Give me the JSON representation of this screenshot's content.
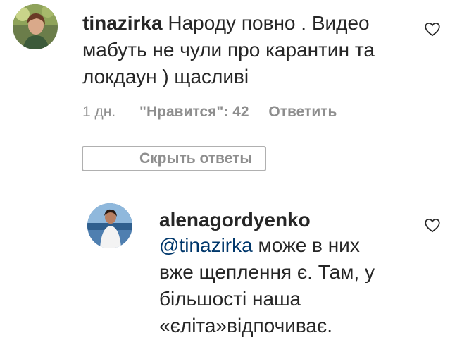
{
  "comments": [
    {
      "username": "tinazirka",
      "text": "Народу повно . Видео мабуть не чули про карантин та локдаун ) щасливі",
      "lines": [
        "Народу повно . Видео",
        "мабуть не чули про карантин та",
        "локдаун ) щасливі"
      ],
      "time": "1 дн.",
      "likes": "\"Нравится\": 42",
      "reply_label": "Ответить",
      "icon": "heart-outline-icon"
    }
  ],
  "hide_replies_label": "Скрыть ответы",
  "reply": {
    "username": "alenagordyenko",
    "mention": "@tinazirka",
    "text_first": " може в них",
    "lines": [
      "вже щеплення є. Там, у",
      "більшості наша",
      "«єліта»відпочиває."
    ],
    "icon": "heart-outline-icon"
  },
  "colors": {
    "text": "#262626",
    "muted": "#8e8e8e",
    "mention": "#00376b"
  }
}
